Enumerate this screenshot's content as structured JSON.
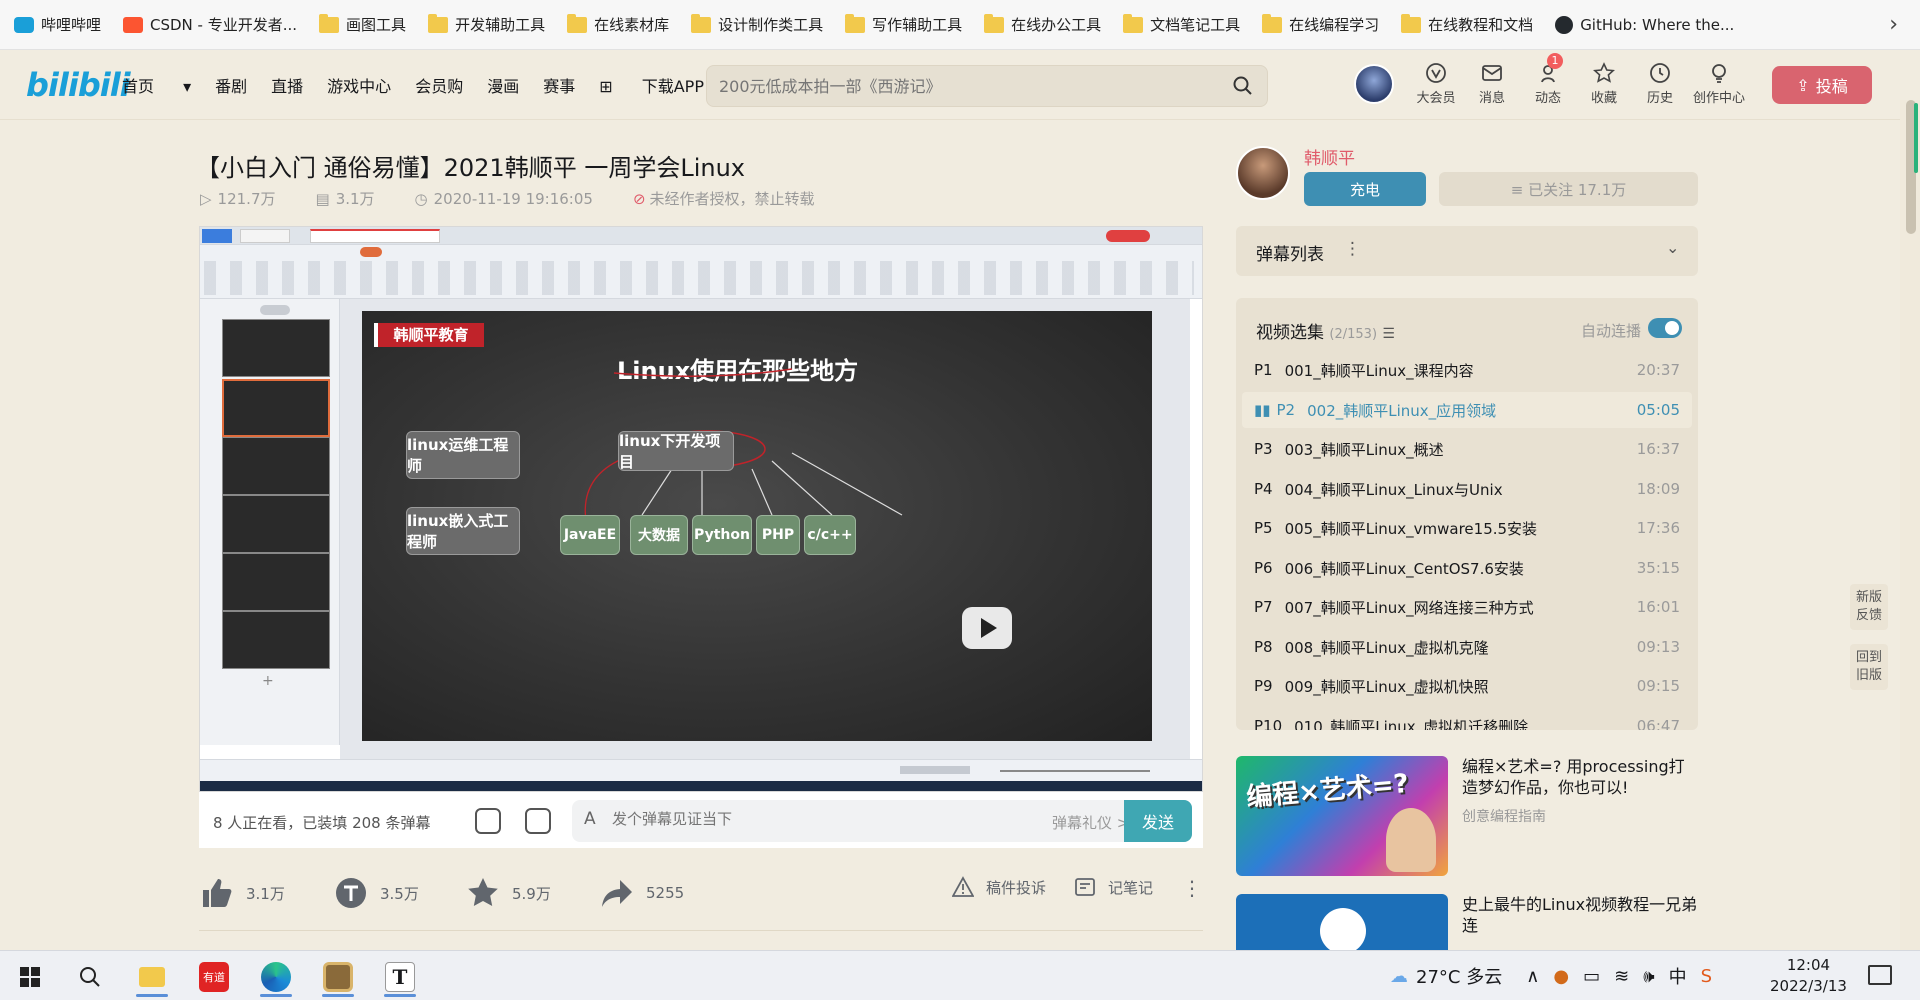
{
  "bookmarks": [
    {
      "label": "哔哩哔哩",
      "icon": "bilibili-icon"
    },
    {
      "label": "CSDN - 专业开发者...",
      "icon": "csdn-icon"
    },
    {
      "label": "画图工具",
      "icon": "folder-icon"
    },
    {
      "label": "开发辅助工具",
      "icon": "folder-icon"
    },
    {
      "label": "在线素材库",
      "icon": "folder-icon"
    },
    {
      "label": "设计制作类工具",
      "icon": "folder-icon"
    },
    {
      "label": "写作辅助工具",
      "icon": "folder-icon"
    },
    {
      "label": "在线办公工具",
      "icon": "folder-icon"
    },
    {
      "label": "文档笔记工具",
      "icon": "folder-icon"
    },
    {
      "label": "在线编程学习",
      "icon": "folder-icon"
    },
    {
      "label": "在线教程和文档",
      "icon": "folder-icon"
    },
    {
      "label": "GitHub: Where the...",
      "icon": "github-icon"
    }
  ],
  "header": {
    "logo": "bilibili",
    "nav": [
      "首页",
      "番剧",
      "直播",
      "游戏中心",
      "会员购",
      "漫画",
      "赛事",
      "下载APP"
    ],
    "search_placeholder": "200元低成本拍一部《西游记》",
    "icons": [
      {
        "label": "大会员",
        "icon": "vip-icon"
      },
      {
        "label": "消息",
        "icon": "message-icon"
      },
      {
        "label": "动态",
        "icon": "dynamic-icon"
      },
      {
        "label": "收藏",
        "icon": "star-icon"
      },
      {
        "label": "历史",
        "icon": "clock-icon"
      },
      {
        "label": "创作中心",
        "icon": "bulb-icon"
      }
    ],
    "dynamic_badge": "1",
    "upload_label": "投稿",
    "accent": "#d9646f"
  },
  "video": {
    "title": "【小白入门 通俗易懂】2021韩顺平 一周学会Linux",
    "views": "121.7万",
    "danmaku_count": "3.1万",
    "date": "2020-11-19 19:16:05",
    "notice": "未经作者授权，禁止转载"
  },
  "slide": {
    "brand": "韩顺平教育",
    "title": "Linux使用在那些地方",
    "left_boxes": [
      "linux运维工程师",
      "linux嵌入式工程师"
    ],
    "center_box": "linux下开发项目",
    "children": [
      "JavaEE",
      "大数据",
      "Python",
      "PHP",
      "c/c++"
    ]
  },
  "danmaku_bar": {
    "status": "8 人正在看，已装填 208 条弹幕",
    "placeholder": "发个弹幕见证当下",
    "etiquette": "弹幕礼仪 >",
    "send": "发送"
  },
  "actions": {
    "like": "3.1万",
    "coin": "3.5万",
    "favorite": "5.9万",
    "share": "5255",
    "report": "稿件投诉",
    "note": "记笔记"
  },
  "uploader": {
    "name": "韩顺平",
    "charge": "充电",
    "follow": "≡ 已关注 17.1万",
    "accent": "#3e8fb3"
  },
  "danmaku_list": {
    "title": "弹幕列表"
  },
  "playlist": {
    "title": "视频选集",
    "progress": "(2/153)",
    "autoplay_label": "自动连播",
    "autoplay_on": true,
    "items": [
      {
        "p": "P1",
        "title": "001_韩顺平Linux_课程内容",
        "dur": "20:37"
      },
      {
        "p": "P2",
        "title": "002_韩顺平Linux_应用领域",
        "dur": "05:05",
        "current": true
      },
      {
        "p": "P3",
        "title": "003_韩顺平Linux_概述",
        "dur": "16:37"
      },
      {
        "p": "P4",
        "title": "004_韩顺平Linux_Linux与Unix",
        "dur": "18:09"
      },
      {
        "p": "P5",
        "title": "005_韩顺平Linux_vmware15.5安装",
        "dur": "17:36"
      },
      {
        "p": "P6",
        "title": "006_韩顺平Linux_CentOS7.6安装",
        "dur": "35:15"
      },
      {
        "p": "P7",
        "title": "007_韩顺平Linux_网络连接三种方式",
        "dur": "16:01"
      },
      {
        "p": "P8",
        "title": "008_韩顺平Linux_虚拟机克隆",
        "dur": "09:13"
      },
      {
        "p": "P9",
        "title": "009_韩顺平Linux_虚拟机快照",
        "dur": "09:15"
      },
      {
        "p": "P10",
        "title": "010_韩顺平Linux_虚拟机迁移删除",
        "dur": "06:47"
      }
    ]
  },
  "recommend": [
    {
      "title": "编程×艺术=? 用processing打造梦幻作品，你也可以!",
      "author": "创意编程指南",
      "thumb_text": "编程×艺术=?"
    },
    {
      "title": "史上最牛的Linux视频教程一兄弟连",
      "author": ""
    }
  ],
  "side_buttons": [
    "新版反馈",
    "回到旧版"
  ],
  "taskbar": {
    "weather": "27°C 多云",
    "time": "12:04",
    "date": "2022/3/13",
    "ime": "中",
    "apps": [
      {
        "name": "start",
        "icon": "windows-icon"
      },
      {
        "name": "search",
        "icon": "search-icon"
      },
      {
        "name": "explorer",
        "icon": "folder-icon"
      },
      {
        "name": "youdao",
        "icon": "youdao-icon",
        "label": "有道"
      },
      {
        "name": "edge",
        "icon": "edge-icon"
      },
      {
        "name": "app",
        "icon": "app-icon"
      },
      {
        "name": "typora",
        "icon": "typora-icon",
        "label": "T"
      }
    ]
  }
}
